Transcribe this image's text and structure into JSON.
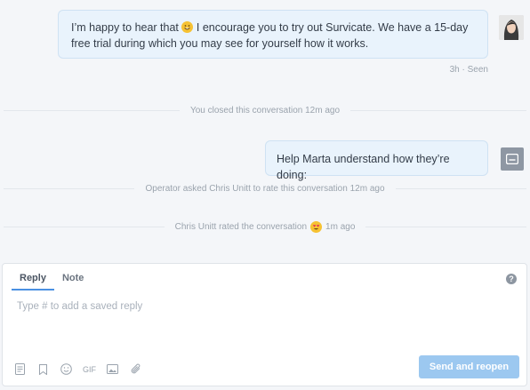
{
  "conversation": {
    "message1": {
      "text": "I’m happy to hear that",
      "emoji_icon": "smile-emoji-icon",
      "text_after_emoji": "I encourage you to try out Survicate. We have a 15-day free trial during which you may see for yourself how it works.",
      "meta": "3h · Seen"
    },
    "event_closed": "You closed this conversation 12m ago",
    "message2": {
      "text": "Help Marta understand how they’re doing:"
    },
    "event_rate_request": "Operator asked Chris Unitt to rate this conversation 12m ago",
    "event_rated": {
      "text_before": "Chris Unitt rated the conversation",
      "emoji_icon": "heart-eyes-emoji-icon",
      "text_after": "1m ago"
    }
  },
  "composer": {
    "tabs": [
      {
        "label": "Reply"
      },
      {
        "label": "Note"
      }
    ],
    "help_label": "?",
    "placeholder": "Type # to add a saved reply",
    "tools": {
      "saved_replies_icon": "document-icon",
      "bookmark_icon": "bookmark-icon",
      "emoji_icon": "smile-icon",
      "gif_label": "GIF",
      "image_icon": "image-icon",
      "attach_icon": "paperclip-icon"
    },
    "send_label": "Send and reopen"
  },
  "colors": {
    "bubble_bg": "#e9f3fc",
    "accent": "#4a90e2",
    "send_button": "#9cc8f0"
  }
}
